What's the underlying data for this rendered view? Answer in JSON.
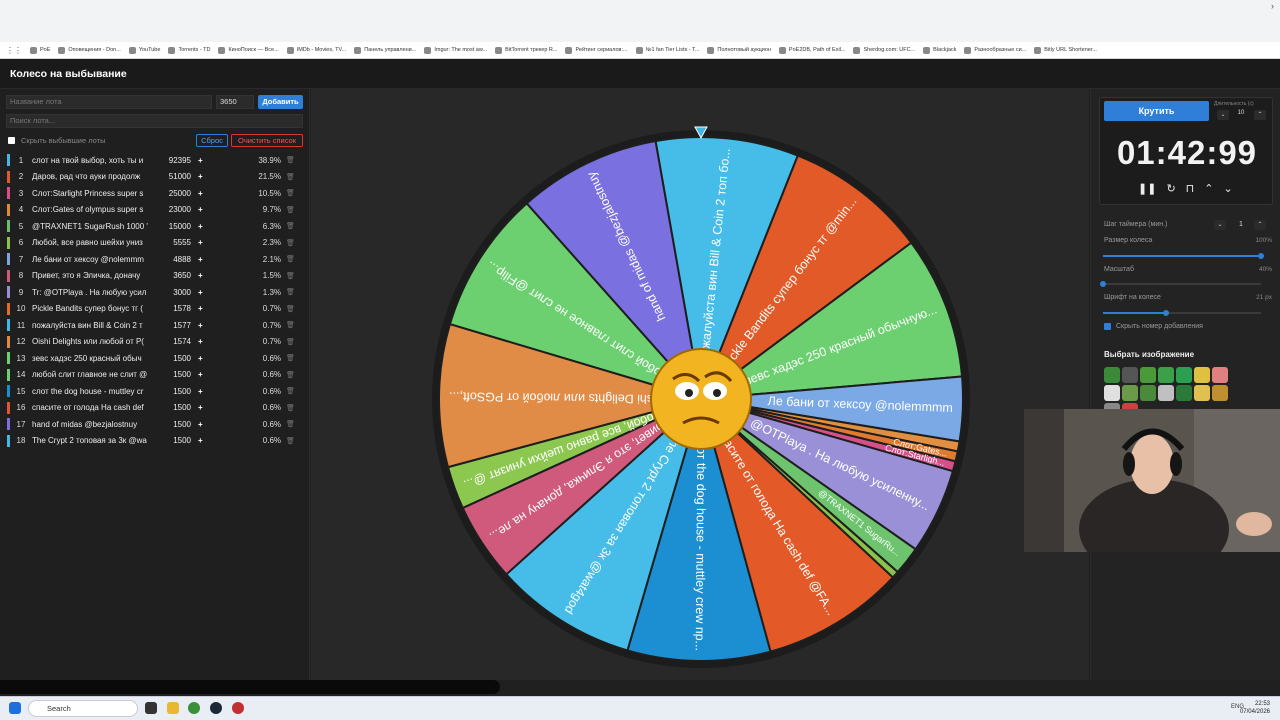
{
  "bookmarks": [
    "PoE",
    "Оповещения - Don...",
    "YouTube",
    "Torrents - TD",
    "КиноПоиск — Все...",
    "IMDb - Movies, TV...",
    "Панель управлени...",
    "Imgur: The most aw...",
    "BitTorrent трекер R...",
    "Рейтинг сериалов:...",
    "№1 fan Tier Lists - T...",
    "Полнотовый аукцион",
    "PoE2DB, Path of Exil...",
    "Sherdog.com: UFC...",
    "Blackjack",
    "Разнообразные си...",
    "Bitly URL Shortener..."
  ],
  "page_title": "Колесо на выбывание",
  "lot_form": {
    "name_placeholder": "Название лота",
    "amount_value": "3650",
    "add_label": "Добавить",
    "search_placeholder": "Поиск лота..."
  },
  "list_controls": {
    "hide_label": "Скрыть выбывшие лоты",
    "reset_label": "Сброс",
    "clear_label": "Очистить список"
  },
  "lots": [
    {
      "n": "1",
      "name": "слот на твой выбор, хоть ты и",
      "amount": "92395",
      "pct": "38.9%",
      "color": "#46b6e6"
    },
    {
      "n": "2",
      "name": "Даров, рад что ауки продолж",
      "amount": "51000",
      "pct": "21.5%",
      "color": "#e05a2a"
    },
    {
      "n": "3",
      "name": "Слот:Starlight Princess super s",
      "amount": "25000",
      "pct": "10.5%",
      "color": "#d94d8a"
    },
    {
      "n": "4",
      "name": "Слот:Gates of olympus super s",
      "amount": "23000",
      "pct": "9.7%",
      "color": "#e0892f"
    },
    {
      "n": "5",
      "name": "@TRAXNET1 SugarRush 1000 '",
      "amount": "15000",
      "pct": "6.3%",
      "color": "#6cc06c"
    },
    {
      "n": "6",
      "name": "Любой, все равно шейхи униз",
      "amount": "5555",
      "pct": "2.3%",
      "color": "#8bc34a"
    },
    {
      "n": "7",
      "name": "Ле бани от хексоу @nolemmm",
      "amount": "4888",
      "pct": "2.1%",
      "color": "#7aa7e0"
    },
    {
      "n": "8",
      "name": "Привет, это я Эличка, доначу",
      "amount": "3650",
      "pct": "1.5%",
      "color": "#d05a7a"
    },
    {
      "n": "9",
      "name": "Tr: @OTPlaya . На любую усил",
      "amount": "3000",
      "pct": "1.3%",
      "color": "#9a8fd6"
    },
    {
      "n": "10",
      "name": "Pickle Bandits супер бонус тг (",
      "amount": "1578",
      "pct": "0.7%",
      "color": "#e86a28"
    },
    {
      "n": "11",
      "name": "пожалуйста вин Bill & Coin 2 т",
      "amount": "1577",
      "pct": "0.7%",
      "color": "#3fb9e8"
    },
    {
      "n": "12",
      "name": "Oishi Delights или любой от P(",
      "amount": "1574",
      "pct": "0.7%",
      "color": "#e08a40"
    },
    {
      "n": "13",
      "name": "зевс хадэс 250 красный обыч",
      "amount": "1500",
      "pct": "0.6%",
      "color": "#6fd06f"
    },
    {
      "n": "14",
      "name": "любой слит главное не слит @",
      "amount": "1500",
      "pct": "0.6%",
      "color": "#6fd06f"
    },
    {
      "n": "15",
      "name": "слот the dog house - muttley cr",
      "amount": "1500",
      "pct": "0.6%",
      "color": "#1a8fd0"
    },
    {
      "n": "16",
      "name": "спасите от голода На cash def",
      "amount": "1500",
      "pct": "0.6%",
      "color": "#e0582a"
    },
    {
      "n": "17",
      "name": "hand of midas @bezjalostnuy",
      "amount": "1500",
      "pct": "0.6%",
      "color": "#7b6fe0"
    },
    {
      "n": "18",
      "name": "The Crypt 2 топовая за 3к @wa",
      "amount": "1500",
      "pct": "0.6%",
      "color": "#46b6e6"
    }
  ],
  "wheel": {
    "segments": [
      {
        "label": "пожалуйста вин Bill & Coin 2 топ бо...",
        "weight": 1,
        "color": "#46bce8"
      },
      {
        "label": "Pickle Bandits супер бонус тг @min...",
        "weight": 1,
        "color": "#e25a28"
      },
      {
        "label": "зевс хадэс 250 красный обычную...",
        "weight": 1,
        "color": "#6cd070"
      },
      {
        "label": "Ле бани от хексоу @nolemmmm",
        "weight": 0.45,
        "color": "#7aa9e6"
      },
      {
        "label": "",
        "weight": 0.07,
        "color": "#e09040"
      },
      {
        "label": "Слот:Gates...",
        "weight": 0.07,
        "color": "#e07a30"
      },
      {
        "label": "Слот:Starligh...",
        "weight": 0.07,
        "color": "#d8508a"
      },
      {
        "label": "Tr: @OTPlaya . На любую усиленну...",
        "weight": 0.6,
        "color": "#9a90d8"
      },
      {
        "label": "@TRAXNET1 SugarRu...",
        "weight": 0.2,
        "color": "#6ec46e"
      },
      {
        "label": "",
        "weight": 0.05,
        "color": "#8bc34a"
      },
      {
        "label": "спасите от голода На cash def @FA...",
        "weight": 1,
        "color": "#e35a28"
      },
      {
        "label": "слот the dog house - muttley crew пр...",
        "weight": 1,
        "color": "#1b8fd2"
      },
      {
        "label": "The Crypt 2 топовая за 3к @wat4god",
        "weight": 1,
        "color": "#46bce8"
      },
      {
        "label": "Привет, это я Эличка, доначу на ле...",
        "weight": 0.55,
        "color": "#cf5a7c"
      },
      {
        "label": "Любой, все равно шейхи унизят @...",
        "weight": 0.3,
        "color": "#8cc850"
      },
      {
        "label": "Oishi Delights или любой от PGSoft,...",
        "weight": 1,
        "color": "#e08c46"
      },
      {
        "label": "любой слит главное не слит @Filip...",
        "weight": 1,
        "color": "#6cd070"
      },
      {
        "label": "hand of midas @bezjalostnuy",
        "weight": 1,
        "color": "#7b70e0"
      }
    ]
  },
  "controls": {
    "spin_label": "Крутить",
    "duration_label": "Длительность (с)",
    "duration_value": "10",
    "timer": "01:42:99",
    "timer_step_label": "Шаг таймера (мин.)",
    "timer_step_value": "1",
    "wheel_size_label": "Размер колеса",
    "wheel_size_value": "100%",
    "wheel_size_fraction": 1.0,
    "scale_label": "Масштаб",
    "scale_value": "40%",
    "scale_fraction": 0.0,
    "font_label": "Шрифт на колесе",
    "font_value": "21 px",
    "font_fraction": 0.4,
    "hide_number_label": "Скрыть номер добавления",
    "choose_image_label": "Выбрать изображение"
  },
  "image_options": [
    "#3a8a3a",
    "#555",
    "#4a9a3a",
    "#3aa04a",
    "#2aa050",
    "#e0c040",
    "#e08080",
    "#e0e0e0",
    "#6a9a4a",
    "#4a8a3a",
    "#c0c0c0",
    "#2a7a3a",
    "#e0c050",
    "#c09030",
    "#888",
    "#d04040"
  ],
  "taskbar": {
    "search_label": "Search",
    "lang": "ENG",
    "time": "22:53",
    "date": "07/04/2026"
  }
}
